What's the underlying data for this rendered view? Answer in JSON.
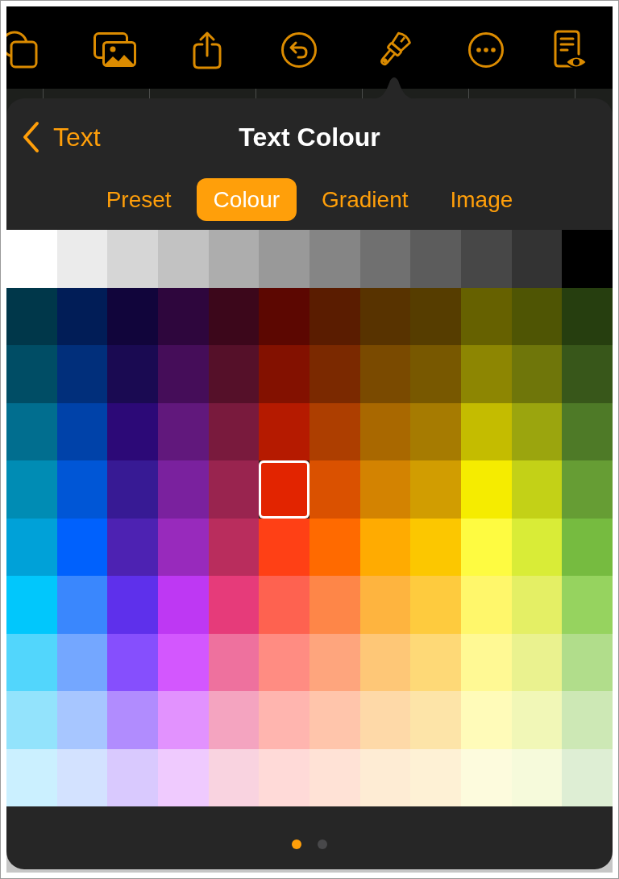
{
  "header": {
    "back_label": "Text",
    "title": "Text Colour"
  },
  "tabs": [
    {
      "label": "Preset",
      "selected": false
    },
    {
      "label": "Colour",
      "selected": true
    },
    {
      "label": "Gradient",
      "selected": false
    },
    {
      "label": "Image",
      "selected": false
    }
  ],
  "swatch_grid": [
    [
      {
        "color": "#ffffff",
        "selected": false
      },
      {
        "color": "#ebebeb",
        "selected": false
      },
      {
        "color": "#d6d6d6",
        "selected": false
      },
      {
        "color": "#c2c2c2",
        "selected": false
      },
      {
        "color": "#adadad",
        "selected": false
      },
      {
        "color": "#999999",
        "selected": false
      },
      {
        "color": "#858585",
        "selected": false
      },
      {
        "color": "#707070",
        "selected": false
      },
      {
        "color": "#5c5c5c",
        "selected": false
      },
      {
        "color": "#474747",
        "selected": false
      },
      {
        "color": "#333333",
        "selected": false
      },
      {
        "color": "#000000",
        "selected": false
      }
    ],
    [
      {
        "color": "#00374a",
        "selected": false
      },
      {
        "color": "#011d57",
        "selected": false
      },
      {
        "color": "#11053b",
        "selected": false
      },
      {
        "color": "#2e063d",
        "selected": false
      },
      {
        "color": "#3c071b",
        "selected": false
      },
      {
        "color": "#5c0701",
        "selected": false
      },
      {
        "color": "#5a1c00",
        "selected": false
      },
      {
        "color": "#583300",
        "selected": false
      },
      {
        "color": "#563d00",
        "selected": false
      },
      {
        "color": "#666100",
        "selected": false
      },
      {
        "color": "#4f5504",
        "selected": false
      },
      {
        "color": "#263e0f",
        "selected": false
      }
    ],
    [
      {
        "color": "#004d65",
        "selected": false
      },
      {
        "color": "#012f7b",
        "selected": false
      },
      {
        "color": "#1a0a52",
        "selected": false
      },
      {
        "color": "#450d59",
        "selected": false
      },
      {
        "color": "#551029",
        "selected": false
      },
      {
        "color": "#831100",
        "selected": false
      },
      {
        "color": "#7b2900",
        "selected": false
      },
      {
        "color": "#7a4a00",
        "selected": false
      },
      {
        "color": "#785800",
        "selected": false
      },
      {
        "color": "#8d8602",
        "selected": false
      },
      {
        "color": "#6f760a",
        "selected": false
      },
      {
        "color": "#38571a",
        "selected": false
      }
    ],
    [
      {
        "color": "#016e8f",
        "selected": false
      },
      {
        "color": "#0042a9",
        "selected": false
      },
      {
        "color": "#2c0977",
        "selected": false
      },
      {
        "color": "#61187c",
        "selected": false
      },
      {
        "color": "#791a3d",
        "selected": false
      },
      {
        "color": "#b51a00",
        "selected": false
      },
      {
        "color": "#ad3e00",
        "selected": false
      },
      {
        "color": "#a96800",
        "selected": false
      },
      {
        "color": "#a67b01",
        "selected": false
      },
      {
        "color": "#c4bc00",
        "selected": false
      },
      {
        "color": "#9ba50e",
        "selected": false
      },
      {
        "color": "#4e7a27",
        "selected": false
      }
    ],
    [
      {
        "color": "#008cb4",
        "selected": false
      },
      {
        "color": "#0056d6",
        "selected": false
      },
      {
        "color": "#371a94",
        "selected": false
      },
      {
        "color": "#7a219e",
        "selected": false
      },
      {
        "color": "#99244f",
        "selected": false
      },
      {
        "color": "#e22400",
        "selected": true
      },
      {
        "color": "#da5100",
        "selected": false
      },
      {
        "color": "#d38301",
        "selected": false
      },
      {
        "color": "#d19d01",
        "selected": false
      },
      {
        "color": "#f5ec00",
        "selected": false
      },
      {
        "color": "#c3d117",
        "selected": false
      },
      {
        "color": "#669d34",
        "selected": false
      }
    ],
    [
      {
        "color": "#00a1d8",
        "selected": false
      },
      {
        "color": "#0061fd",
        "selected": false
      },
      {
        "color": "#4d22b2",
        "selected": false
      },
      {
        "color": "#982abc",
        "selected": false
      },
      {
        "color": "#b92d5d",
        "selected": false
      },
      {
        "color": "#ff4015",
        "selected": false
      },
      {
        "color": "#ff6a00",
        "selected": false
      },
      {
        "color": "#ffab01",
        "selected": false
      },
      {
        "color": "#fcc700",
        "selected": false
      },
      {
        "color": "#fefb41",
        "selected": false
      },
      {
        "color": "#d9ec37",
        "selected": false
      },
      {
        "color": "#76bb40",
        "selected": false
      }
    ],
    [
      {
        "color": "#01c7fc",
        "selected": false
      },
      {
        "color": "#3a87fd",
        "selected": false
      },
      {
        "color": "#5e30eb",
        "selected": false
      },
      {
        "color": "#be38f3",
        "selected": false
      },
      {
        "color": "#e63b7a",
        "selected": false
      },
      {
        "color": "#fe6250",
        "selected": false
      },
      {
        "color": "#fe8648",
        "selected": false
      },
      {
        "color": "#feb43f",
        "selected": false
      },
      {
        "color": "#fecb3e",
        "selected": false
      },
      {
        "color": "#fff76b",
        "selected": false
      },
      {
        "color": "#e4ef65",
        "selected": false
      },
      {
        "color": "#96d35f",
        "selected": false
      }
    ],
    [
      {
        "color": "#52d6fc",
        "selected": false
      },
      {
        "color": "#74a7ff",
        "selected": false
      },
      {
        "color": "#864ffd",
        "selected": false
      },
      {
        "color": "#d357fe",
        "selected": false
      },
      {
        "color": "#ee719e",
        "selected": false
      },
      {
        "color": "#ff8c82",
        "selected": false
      },
      {
        "color": "#fea57d",
        "selected": false
      },
      {
        "color": "#fec777",
        "selected": false
      },
      {
        "color": "#fed977",
        "selected": false
      },
      {
        "color": "#fff994",
        "selected": false
      },
      {
        "color": "#eaf28f",
        "selected": false
      },
      {
        "color": "#b1dd8b",
        "selected": false
      }
    ],
    [
      {
        "color": "#93e3fc",
        "selected": false
      },
      {
        "color": "#a7c6ff",
        "selected": false
      },
      {
        "color": "#b18cfe",
        "selected": false
      },
      {
        "color": "#e292fe",
        "selected": false
      },
      {
        "color": "#f4a4c0",
        "selected": false
      },
      {
        "color": "#ffb5af",
        "selected": false
      },
      {
        "color": "#ffc5ab",
        "selected": false
      },
      {
        "color": "#fed9a8",
        "selected": false
      },
      {
        "color": "#fde4a8",
        "selected": false
      },
      {
        "color": "#fffbb9",
        "selected": false
      },
      {
        "color": "#f1f7b7",
        "selected": false
      },
      {
        "color": "#cde8b5",
        "selected": false
      }
    ],
    [
      {
        "color": "#cbf0ff",
        "selected": false
      },
      {
        "color": "#d3e2ff",
        "selected": false
      },
      {
        "color": "#d9c9fe",
        "selected": false
      },
      {
        "color": "#efcafe",
        "selected": false
      },
      {
        "color": "#f9d3e0",
        "selected": false
      },
      {
        "color": "#ffdad8",
        "selected": false
      },
      {
        "color": "#ffe2d6",
        "selected": false
      },
      {
        "color": "#feecd4",
        "selected": false
      },
      {
        "color": "#fef1d5",
        "selected": false
      },
      {
        "color": "#fdfbdd",
        "selected": false
      },
      {
        "color": "#f6fadb",
        "selected": false
      },
      {
        "color": "#deeed4",
        "selected": false
      }
    ]
  ],
  "page_dots": [
    {
      "selected": true
    },
    {
      "selected": false
    }
  ]
}
